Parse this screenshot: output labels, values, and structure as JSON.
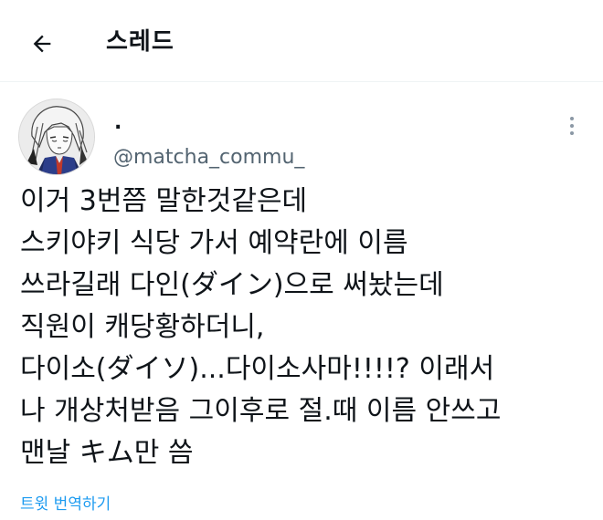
{
  "header": {
    "title": "스레드",
    "back_icon": "arrow-left-icon"
  },
  "tweet": {
    "display_name": ".",
    "handle": "@matcha_commu_",
    "avatar_icon": "anime-character-avatar",
    "more_icon": "more-vertical-icon",
    "lines": [
      "이거 3번쯤 말한것같은데",
      "스키야키 식당 가서 예약란에 이름",
      "쓰라길래 다인(ダイン)으로 써놨는데",
      "직원이 캐당황하더니,",
      "다이소(ダイソ)...다이소사마!!!!? 이래서",
      "나 개상처받음 그이후로 절.때 이름 안쓰고",
      "맨날 キム만 씀"
    ],
    "translate_label": "트윗 번역하기"
  },
  "colors": {
    "text": "#0f1419",
    "secondary": "#536471",
    "link": "#1d9bf0",
    "divider": "#eff3f4"
  }
}
